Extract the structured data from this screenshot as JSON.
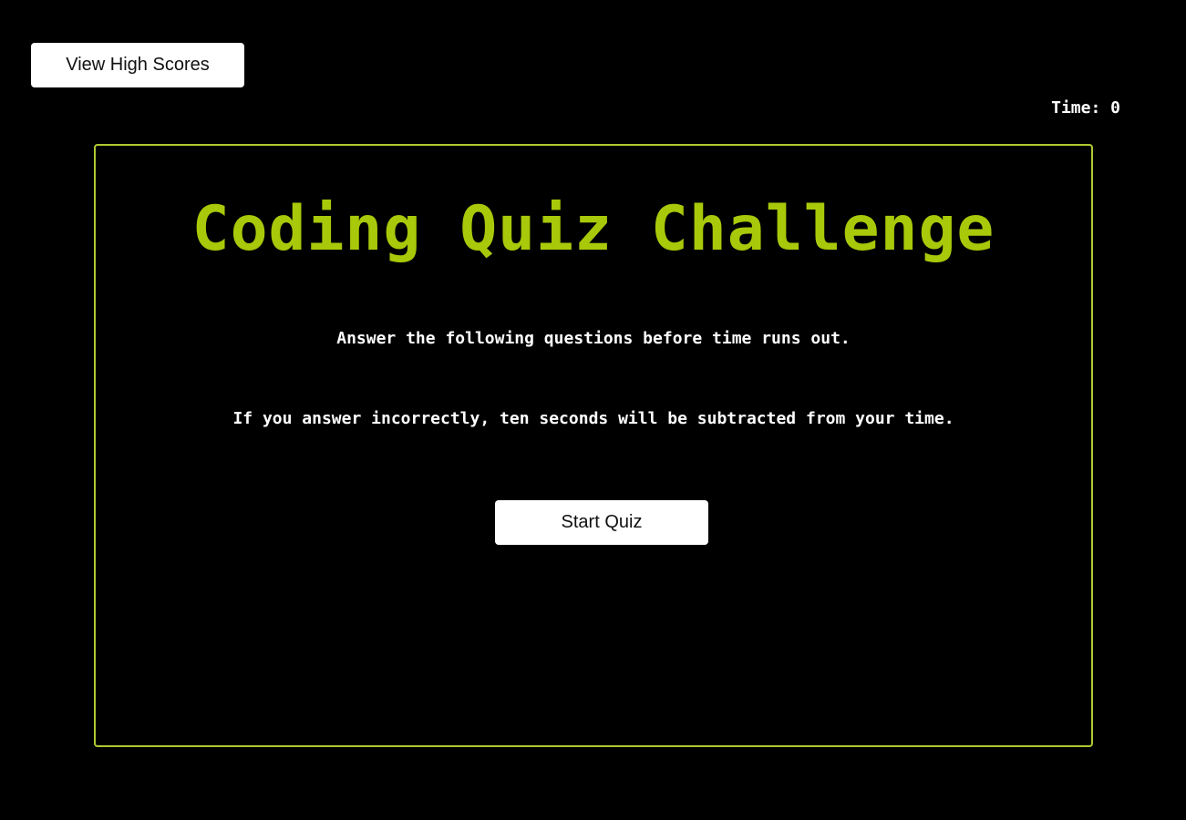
{
  "header": {
    "high_scores_label": "View High Scores",
    "timer_label": "Time: ",
    "timer_value": "0"
  },
  "quiz": {
    "title": "Coding Quiz Challenge",
    "instruction_1": "Answer the following questions before time runs out.",
    "instruction_2": "If you answer incorrectly, ten seconds will be subtracted from your time.",
    "start_label": "Start Quiz"
  },
  "colors": {
    "background": "#000000",
    "accent": "#a8c80a",
    "border": "#b0c832",
    "button_bg": "#ffffff"
  }
}
